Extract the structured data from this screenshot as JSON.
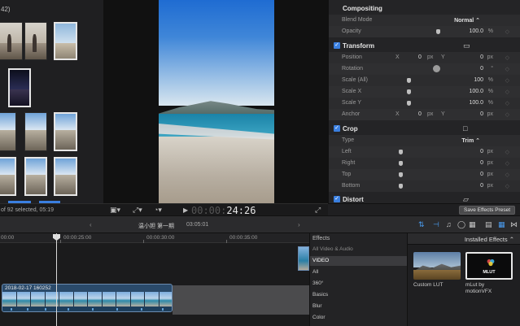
{
  "browser": {
    "count_label": "42)",
    "footer_status": "of 92 selected, 05:19"
  },
  "viewer": {
    "timecode_dim": "00:00:",
    "timecode_bright": "24:26"
  },
  "inspector": {
    "compositing": {
      "title": "Compositing",
      "blend_mode_label": "Blend Mode",
      "blend_mode_value": "Normal ⌃",
      "opacity_label": "Opacity",
      "opacity_value": "100.0",
      "opacity_unit": "%"
    },
    "transform": {
      "title": "Transform",
      "position_label": "Position",
      "position_x": "0",
      "position_y": "0",
      "unit_px": "px",
      "axis_x": "X",
      "axis_y": "Y",
      "rotation_label": "Rotation",
      "rotation_value": "0",
      "rotation_unit": "°",
      "scale_all_label": "Scale (All)",
      "scale_all_value": "100",
      "scale_x_label": "Scale X",
      "scale_x_value": "100.0",
      "scale_y_label": "Scale Y",
      "scale_y_value": "100.0",
      "anchor_label": "Anchor",
      "anchor_x": "0",
      "anchor_y": "0",
      "percent": "%"
    },
    "crop": {
      "title": "Crop",
      "type_label": "Type",
      "type_value": "Trim ⌃",
      "left_label": "Left",
      "left_value": "0",
      "right_label": "Right",
      "right_value": "0",
      "top_label": "Top",
      "top_value": "0",
      "bottom_label": "Bottom",
      "bottom_value": "0"
    },
    "distort": {
      "title": "Distort"
    },
    "save_preset_label": "Save Effects Preset"
  },
  "timeline_toolbar": {
    "project_name": "温小妲 第一期",
    "project_duration": "03:05:01"
  },
  "timeline": {
    "ruler": [
      "00:00",
      "00:00:25:00",
      "00:00:30:00",
      "00:00:35:00"
    ],
    "clip_name": "2018-02-17 160252"
  },
  "effects": {
    "title": "Effects",
    "items": [
      {
        "label": "All Video & Audio",
        "kind": "header"
      },
      {
        "label": "VIDEO",
        "kind": "selected"
      },
      {
        "label": "All",
        "kind": "normal"
      },
      {
        "label": "360°",
        "kind": "normal"
      },
      {
        "label": "Basics",
        "kind": "normal"
      },
      {
        "label": "Blur",
        "kind": "normal"
      },
      {
        "label": "Color",
        "kind": "normal"
      }
    ],
    "installed_label": "Installed Effects ⌃",
    "tiles": [
      {
        "caption": "Custom LUT"
      },
      {
        "caption_line1": "mLut by",
        "caption_line2": "motionVFX",
        "logo_text": "MLUT"
      }
    ]
  },
  "colors": {
    "accent_blue": "#3a7fe0",
    "clip_blue": "#2a4a6a",
    "background": "#1c1c1e"
  }
}
